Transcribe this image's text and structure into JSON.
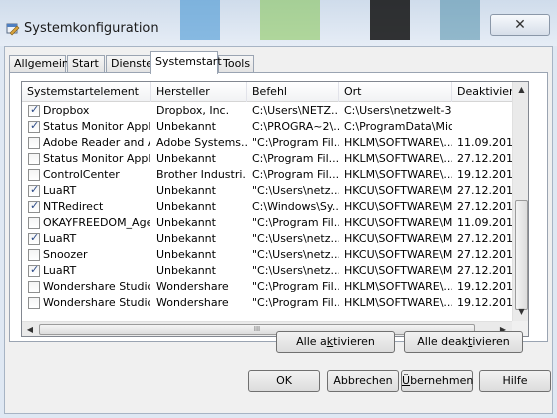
{
  "window": {
    "title": "Systemkonfiguration",
    "close_glyph": "✕"
  },
  "tabs": [
    {
      "label": "Allgemein"
    },
    {
      "label": "Start"
    },
    {
      "label": "Dienste"
    },
    {
      "label": "Systemstart"
    },
    {
      "label": "Tools"
    }
  ],
  "active_tab": "Systemstart",
  "table": {
    "columns": [
      "Systemstartelement",
      "Hersteller",
      "Befehl",
      "Ort",
      "Deaktivier"
    ],
    "rows": [
      {
        "checked": true,
        "cells": [
          "Dropbox",
          "Dropbox, Inc.",
          "C:\\Users\\NETZ...",
          "C:\\Users\\netzwelt-3...",
          ""
        ]
      },
      {
        "checked": true,
        "cells": [
          "Status Monitor Applica...",
          "Unbekannt",
          "C:\\PROGRA~2\\...",
          "C:\\ProgramData\\Mic...",
          ""
        ]
      },
      {
        "checked": false,
        "cells": [
          "Adobe Reader and Ac...",
          "Adobe Systems...",
          "\"C:\\Program Fil...",
          "HKLM\\SOFTWARE\\...",
          "11.09.201"
        ]
      },
      {
        "checked": false,
        "cells": [
          "Status Monitor Applica...",
          "Unbekannt",
          "C:\\Program Fil...",
          "HKLM\\SOFTWARE\\...",
          "27.12.201"
        ]
      },
      {
        "checked": false,
        "cells": [
          "ControlCenter",
          "Brother Industri...",
          "C:\\Program Fil...",
          "HKLM\\SOFTWARE\\...",
          "19.12.201"
        ]
      },
      {
        "checked": true,
        "cells": [
          "LuaRT",
          "Unbekannt",
          "\"C:\\Users\\netz...",
          "HKCU\\SOFTWARE\\M...",
          "27.12.201"
        ]
      },
      {
        "checked": true,
        "cells": [
          "NTRedirect",
          "Unbekannt",
          "C:\\Windows\\Sy...",
          "HKCU\\SOFTWARE\\M...",
          "27.12.201"
        ]
      },
      {
        "checked": false,
        "cells": [
          "OKAYFREEDOM_Agent",
          "Unbekannt",
          "\"C:\\Program Fil...",
          "HKCU\\SOFTWARE\\M...",
          "11.09.201"
        ]
      },
      {
        "checked": true,
        "cells": [
          "LuaRT",
          "Unbekannt",
          "\"C:\\Users\\netz...",
          "HKCU\\SOFTWARE\\M...",
          "27.12.201"
        ]
      },
      {
        "checked": false,
        "cells": [
          "Snoozer",
          "Unbekannt",
          "\"C:\\Users\\netz...",
          "HKCU\\SOFTWARE\\M...",
          "27.12.201"
        ]
      },
      {
        "checked": true,
        "cells": [
          "LuaRT",
          "Unbekannt",
          "\"C:\\Users\\netz...",
          "HKCU\\SOFTWARE\\M...",
          "27.12.201"
        ]
      },
      {
        "checked": false,
        "cells": [
          "Wondershare Studio",
          "Wondershare",
          "\"C:\\Program Fil...",
          "HKLM\\SOFTWARE\\...",
          "19.12.201"
        ]
      },
      {
        "checked": false,
        "cells": [
          "Wondershare Studio",
          "Wondershare",
          "\"C:\\Program Fil...",
          "HKLM\\SOFTWARE\\...",
          "19.12.201"
        ]
      }
    ]
  },
  "scroll": {
    "up": "▲",
    "down": "▼",
    "left": "◀",
    "right": "▶",
    "grip": "III"
  },
  "buttons": {
    "enable_all": {
      "pre": "Alle a",
      "ul": "k",
      "post": "tivieren"
    },
    "disable_all": {
      "pre": "Alle deak",
      "ul": "t",
      "post": "ivieren"
    },
    "ok": "OK",
    "cancel": "Abbrechen",
    "apply": {
      "pre": "",
      "ul": "Ü",
      "post": "bernehmen"
    },
    "help": "Hilfe"
  },
  "colors": {
    "accent": "#2b4a87",
    "title_bg": "#d6e1ef"
  }
}
